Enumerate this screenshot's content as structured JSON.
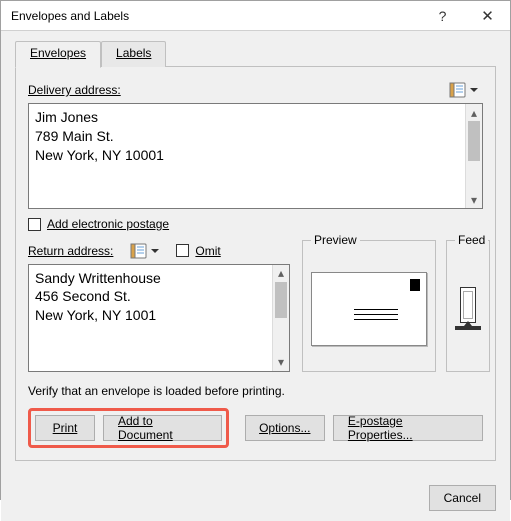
{
  "titlebar": {
    "title": "Envelopes and Labels",
    "help": "?",
    "close": "✕"
  },
  "tabs": {
    "envelopes": "Envelopes",
    "labels": "Labels"
  },
  "delivery": {
    "label": "Delivery address:",
    "value": "Jim Jones\n789 Main St.\nNew York, NY 10001"
  },
  "electronic_postage": {
    "label": "Add electronic postage",
    "checked": false
  },
  "return": {
    "label": "Return address:",
    "omit_label": "Omit",
    "omit_checked": false,
    "value": "Sandy Writtenhouse\n456 Second St.\nNew York, NY 1001"
  },
  "preview": {
    "label": "Preview"
  },
  "feed": {
    "label": "Feed"
  },
  "verify_text": "Verify that an envelope is loaded before printing.",
  "buttons": {
    "print": "Print",
    "add_to_doc": "Add to Document",
    "options": "Options...",
    "epostage": "E-postage Properties...",
    "cancel": "Cancel"
  },
  "icons": {
    "address_book": "address-book-icon",
    "scroll_up": "▴",
    "scroll_down": "▾"
  }
}
